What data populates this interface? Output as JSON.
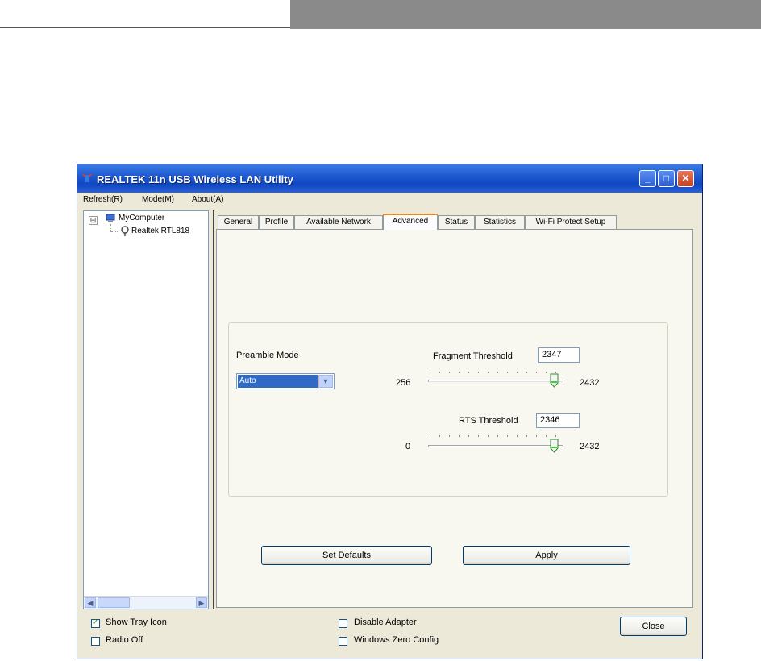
{
  "window": {
    "title": "REALTEK 11n USB Wireless LAN Utility",
    "controls": {
      "minimize": "_",
      "maximize": "□",
      "close": "✕"
    }
  },
  "menu": [
    "Refresh(R)",
    "Mode(M)",
    "About(A)"
  ],
  "tree": {
    "expander": "⊟",
    "root": "MyComputer",
    "child": "Realtek RTL818"
  },
  "tabs": [
    "General",
    "Profile",
    "Available Network",
    "Advanced",
    "Status",
    "Statistics",
    "Wi-Fi Protect Setup"
  ],
  "active_tab": "Advanced",
  "advanced": {
    "preamble_label": "Preamble Mode",
    "preamble_value": "Auto",
    "fragment": {
      "label": "Fragment Threshold",
      "value": "2347",
      "min": "256",
      "max": "2432",
      "level": 2347
    },
    "rts": {
      "label": "RTS Threshold",
      "value": "2346",
      "min": "0",
      "max": "2432",
      "level": 2346
    }
  },
  "buttons": {
    "set_defaults": "Set Defaults",
    "apply": "Apply",
    "close": "Close"
  },
  "options": {
    "show_tray_icon": {
      "label": "Show Tray Icon",
      "checked": true
    },
    "radio_off": {
      "label": "Radio Off",
      "checked": false
    },
    "disable_adapter": {
      "label": "Disable Adapter",
      "checked": false
    },
    "windows_zero_config": {
      "label": "Windows Zero Config",
      "checked": false
    }
  },
  "glyphs": {
    "check": "✓",
    "arrow_left": "◀",
    "arrow_right": "▶",
    "arrow_down": "▼"
  }
}
